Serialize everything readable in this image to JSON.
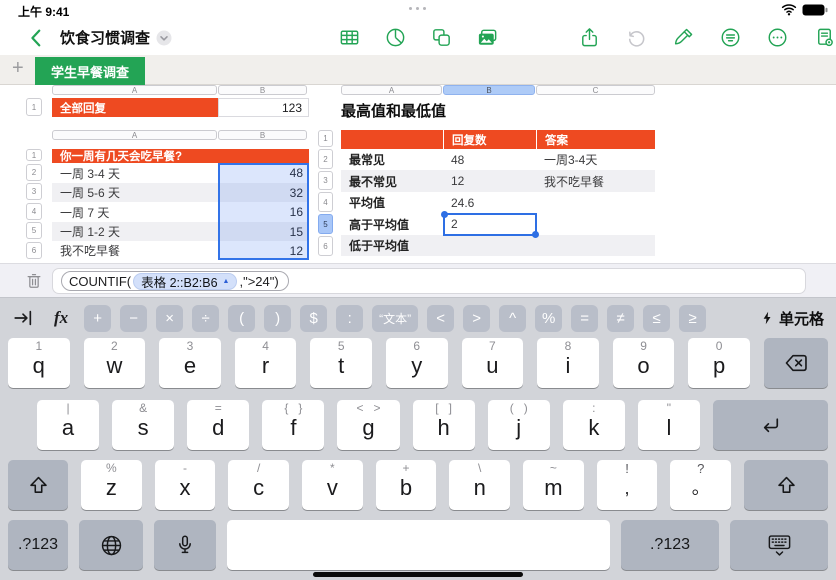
{
  "colors": {
    "accent_green": "#23A455",
    "header_red": "#EE4A21",
    "selection_blue": "#2E6FE4",
    "keyboard_bg": "#D2D4D9"
  },
  "status_bar": {
    "time": "上午 9:41"
  },
  "toolbar": {
    "title": "饮食习惯调查"
  },
  "tab_bar": {
    "add": "+",
    "active_tab": "学生早餐调查"
  },
  "sheet": {
    "table_totals": {
      "columns": [
        "A",
        "B"
      ],
      "row_num": "1",
      "label": "全部回复",
      "value": "123"
    },
    "table_survey": {
      "columns": [
        "A",
        "B"
      ],
      "header_num": "1",
      "header": "你一周有几天会吃早餐?",
      "rows": [
        {
          "num": "2",
          "label": "一周 3-4 天",
          "value": "48"
        },
        {
          "num": "3",
          "label": "一周 5-6 天",
          "value": "32"
        },
        {
          "num": "4",
          "label": "一周 7 天",
          "value": "16"
        },
        {
          "num": "5",
          "label": "一周 1-2 天",
          "value": "15"
        },
        {
          "num": "6",
          "label": "我不吃早餐",
          "value": "12"
        }
      ]
    },
    "table_stats": {
      "columns": [
        "A",
        "B",
        "C"
      ],
      "title": "最高值和最低值",
      "header_num": "1",
      "headers": {
        "b": "回复数",
        "c": "答案"
      },
      "rows": [
        {
          "num": "2",
          "label": "最常见",
          "b": "48",
          "c": "一周3-4天"
        },
        {
          "num": "3",
          "label": "最不常见",
          "b": "12",
          "c": "我不吃早餐"
        },
        {
          "num": "4",
          "label": "平均值",
          "b": "24.6",
          "c": ""
        },
        {
          "num": "5",
          "label": "高于平均值",
          "b": "2",
          "c": ""
        },
        {
          "num": "6",
          "label": "低于平均值",
          "b": "",
          "c": ""
        }
      ]
    }
  },
  "formula_bar": {
    "function": "COUNTIF(",
    "range_token": "表格 2::B2:B6",
    "token_arrow": "▲",
    "args": ",\">24\"",
    "close": ")"
  },
  "keyboard": {
    "accessory": {
      "fx_label": "fx",
      "symbols": [
        "+",
        "−",
        "×",
        "÷",
        "(",
        ")",
        "$",
        ":",
        "“文本”",
        "<",
        ">",
        "^",
        "%",
        "=",
        "≠",
        "≤",
        "≥"
      ],
      "cell_button": "单元格"
    },
    "row1": [
      {
        "m": "q",
        "a": "1"
      },
      {
        "m": "w",
        "a": "2"
      },
      {
        "m": "e",
        "a": "3"
      },
      {
        "m": "r",
        "a": "4"
      },
      {
        "m": "t",
        "a": "5"
      },
      {
        "m": "y",
        "a": "6"
      },
      {
        "m": "u",
        "a": "7"
      },
      {
        "m": "i",
        "a": "8"
      },
      {
        "m": "o",
        "a": "9"
      },
      {
        "m": "p",
        "a": "0"
      }
    ],
    "row2": [
      {
        "m": "a",
        "a": "|"
      },
      {
        "m": "s",
        "a": "&"
      },
      {
        "m": "d",
        "a": "="
      },
      {
        "m": "f",
        "a": "{   }"
      },
      {
        "m": "g",
        "a": "<   >"
      },
      {
        "m": "h",
        "a": "[   ]"
      },
      {
        "m": "j",
        "a": "(   )"
      },
      {
        "m": "k",
        "a": ":"
      },
      {
        "m": "l",
        "a": "\""
      }
    ],
    "row3": [
      {
        "m": "z",
        "a": "%"
      },
      {
        "m": "x",
        "a": "-"
      },
      {
        "m": "c",
        "a": "/"
      },
      {
        "m": "v",
        "a": "*"
      },
      {
        "m": "b",
        "a": "+"
      },
      {
        "m": "n",
        "a": "\\"
      },
      {
        "m": "m",
        "a": "~"
      }
    ],
    "punct": [
      {
        "m": ",",
        "a": "!"
      },
      {
        "m": "。",
        "a": "?"
      }
    ],
    "row4": {
      "sym1": ".?123",
      "sym2": ".?123"
    }
  }
}
